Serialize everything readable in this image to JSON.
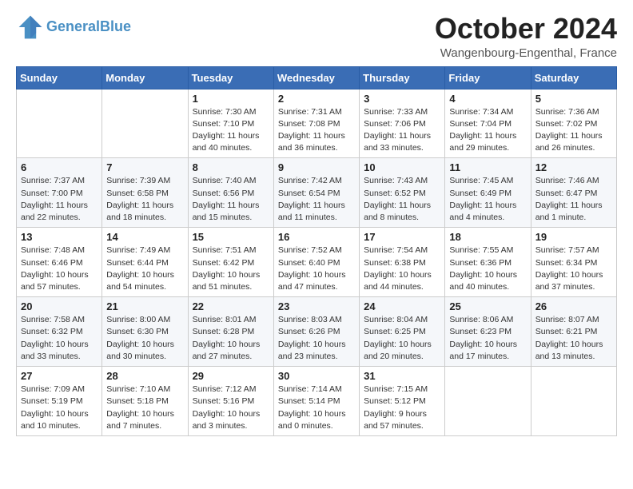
{
  "header": {
    "logo_line1": "General",
    "logo_line2": "Blue",
    "month": "October 2024",
    "location": "Wangenbourg-Engenthal, France"
  },
  "weekdays": [
    "Sunday",
    "Monday",
    "Tuesday",
    "Wednesday",
    "Thursday",
    "Friday",
    "Saturday"
  ],
  "weeks": [
    [
      {
        "day": "",
        "sunrise": "",
        "sunset": "",
        "daylight": ""
      },
      {
        "day": "",
        "sunrise": "",
        "sunset": "",
        "daylight": ""
      },
      {
        "day": "1",
        "sunrise": "Sunrise: 7:30 AM",
        "sunset": "Sunset: 7:10 PM",
        "daylight": "Daylight: 11 hours and 40 minutes."
      },
      {
        "day": "2",
        "sunrise": "Sunrise: 7:31 AM",
        "sunset": "Sunset: 7:08 PM",
        "daylight": "Daylight: 11 hours and 36 minutes."
      },
      {
        "day": "3",
        "sunrise": "Sunrise: 7:33 AM",
        "sunset": "Sunset: 7:06 PM",
        "daylight": "Daylight: 11 hours and 33 minutes."
      },
      {
        "day": "4",
        "sunrise": "Sunrise: 7:34 AM",
        "sunset": "Sunset: 7:04 PM",
        "daylight": "Daylight: 11 hours and 29 minutes."
      },
      {
        "day": "5",
        "sunrise": "Sunrise: 7:36 AM",
        "sunset": "Sunset: 7:02 PM",
        "daylight": "Daylight: 11 hours and 26 minutes."
      }
    ],
    [
      {
        "day": "6",
        "sunrise": "Sunrise: 7:37 AM",
        "sunset": "Sunset: 7:00 PM",
        "daylight": "Daylight: 11 hours and 22 minutes."
      },
      {
        "day": "7",
        "sunrise": "Sunrise: 7:39 AM",
        "sunset": "Sunset: 6:58 PM",
        "daylight": "Daylight: 11 hours and 18 minutes."
      },
      {
        "day": "8",
        "sunrise": "Sunrise: 7:40 AM",
        "sunset": "Sunset: 6:56 PM",
        "daylight": "Daylight: 11 hours and 15 minutes."
      },
      {
        "day": "9",
        "sunrise": "Sunrise: 7:42 AM",
        "sunset": "Sunset: 6:54 PM",
        "daylight": "Daylight: 11 hours and 11 minutes."
      },
      {
        "day": "10",
        "sunrise": "Sunrise: 7:43 AM",
        "sunset": "Sunset: 6:52 PM",
        "daylight": "Daylight: 11 hours and 8 minutes."
      },
      {
        "day": "11",
        "sunrise": "Sunrise: 7:45 AM",
        "sunset": "Sunset: 6:49 PM",
        "daylight": "Daylight: 11 hours and 4 minutes."
      },
      {
        "day": "12",
        "sunrise": "Sunrise: 7:46 AM",
        "sunset": "Sunset: 6:47 PM",
        "daylight": "Daylight: 11 hours and 1 minute."
      }
    ],
    [
      {
        "day": "13",
        "sunrise": "Sunrise: 7:48 AM",
        "sunset": "Sunset: 6:46 PM",
        "daylight": "Daylight: 10 hours and 57 minutes."
      },
      {
        "day": "14",
        "sunrise": "Sunrise: 7:49 AM",
        "sunset": "Sunset: 6:44 PM",
        "daylight": "Daylight: 10 hours and 54 minutes."
      },
      {
        "day": "15",
        "sunrise": "Sunrise: 7:51 AM",
        "sunset": "Sunset: 6:42 PM",
        "daylight": "Daylight: 10 hours and 51 minutes."
      },
      {
        "day": "16",
        "sunrise": "Sunrise: 7:52 AM",
        "sunset": "Sunset: 6:40 PM",
        "daylight": "Daylight: 10 hours and 47 minutes."
      },
      {
        "day": "17",
        "sunrise": "Sunrise: 7:54 AM",
        "sunset": "Sunset: 6:38 PM",
        "daylight": "Daylight: 10 hours and 44 minutes."
      },
      {
        "day": "18",
        "sunrise": "Sunrise: 7:55 AM",
        "sunset": "Sunset: 6:36 PM",
        "daylight": "Daylight: 10 hours and 40 minutes."
      },
      {
        "day": "19",
        "sunrise": "Sunrise: 7:57 AM",
        "sunset": "Sunset: 6:34 PM",
        "daylight": "Daylight: 10 hours and 37 minutes."
      }
    ],
    [
      {
        "day": "20",
        "sunrise": "Sunrise: 7:58 AM",
        "sunset": "Sunset: 6:32 PM",
        "daylight": "Daylight: 10 hours and 33 minutes."
      },
      {
        "day": "21",
        "sunrise": "Sunrise: 8:00 AM",
        "sunset": "Sunset: 6:30 PM",
        "daylight": "Daylight: 10 hours and 30 minutes."
      },
      {
        "day": "22",
        "sunrise": "Sunrise: 8:01 AM",
        "sunset": "Sunset: 6:28 PM",
        "daylight": "Daylight: 10 hours and 27 minutes."
      },
      {
        "day": "23",
        "sunrise": "Sunrise: 8:03 AM",
        "sunset": "Sunset: 6:26 PM",
        "daylight": "Daylight: 10 hours and 23 minutes."
      },
      {
        "day": "24",
        "sunrise": "Sunrise: 8:04 AM",
        "sunset": "Sunset: 6:25 PM",
        "daylight": "Daylight: 10 hours and 20 minutes."
      },
      {
        "day": "25",
        "sunrise": "Sunrise: 8:06 AM",
        "sunset": "Sunset: 6:23 PM",
        "daylight": "Daylight: 10 hours and 17 minutes."
      },
      {
        "day": "26",
        "sunrise": "Sunrise: 8:07 AM",
        "sunset": "Sunset: 6:21 PM",
        "daylight": "Daylight: 10 hours and 13 minutes."
      }
    ],
    [
      {
        "day": "27",
        "sunrise": "Sunrise: 7:09 AM",
        "sunset": "Sunset: 5:19 PM",
        "daylight": "Daylight: 10 hours and 10 minutes."
      },
      {
        "day": "28",
        "sunrise": "Sunrise: 7:10 AM",
        "sunset": "Sunset: 5:18 PM",
        "daylight": "Daylight: 10 hours and 7 minutes."
      },
      {
        "day": "29",
        "sunrise": "Sunrise: 7:12 AM",
        "sunset": "Sunset: 5:16 PM",
        "daylight": "Daylight: 10 hours and 3 minutes."
      },
      {
        "day": "30",
        "sunrise": "Sunrise: 7:14 AM",
        "sunset": "Sunset: 5:14 PM",
        "daylight": "Daylight: 10 hours and 0 minutes."
      },
      {
        "day": "31",
        "sunrise": "Sunrise: 7:15 AM",
        "sunset": "Sunset: 5:12 PM",
        "daylight": "Daylight: 9 hours and 57 minutes."
      },
      {
        "day": "",
        "sunrise": "",
        "sunset": "",
        "daylight": ""
      },
      {
        "day": "",
        "sunrise": "",
        "sunset": "",
        "daylight": ""
      }
    ]
  ]
}
